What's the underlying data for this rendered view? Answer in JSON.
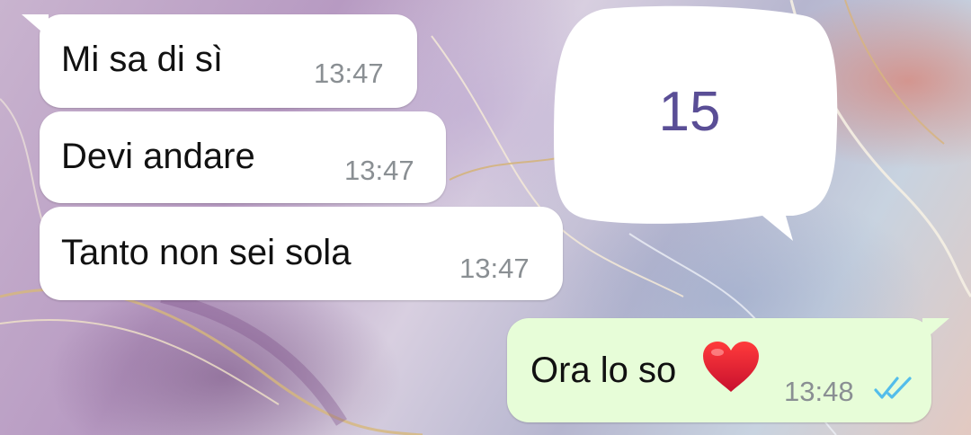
{
  "messages": [
    {
      "direction": "incoming",
      "text": "Mi sa di sì",
      "time": "13:47"
    },
    {
      "direction": "incoming",
      "text": "Devi andare",
      "time": "13:47"
    },
    {
      "direction": "incoming",
      "text": "Tanto non sei sola",
      "time": "13:47"
    },
    {
      "direction": "outgoing",
      "text": "Ora lo so",
      "emoji": "heart-emoji",
      "time": "13:48",
      "status": "read"
    }
  ],
  "overlay": {
    "label": "15"
  },
  "colors": {
    "incoming_bubble": "#ffffff",
    "outgoing_bubble": "#e7fdd8",
    "read_ticks": "#53bdeb",
    "overlay_number": "#5a4e96"
  }
}
